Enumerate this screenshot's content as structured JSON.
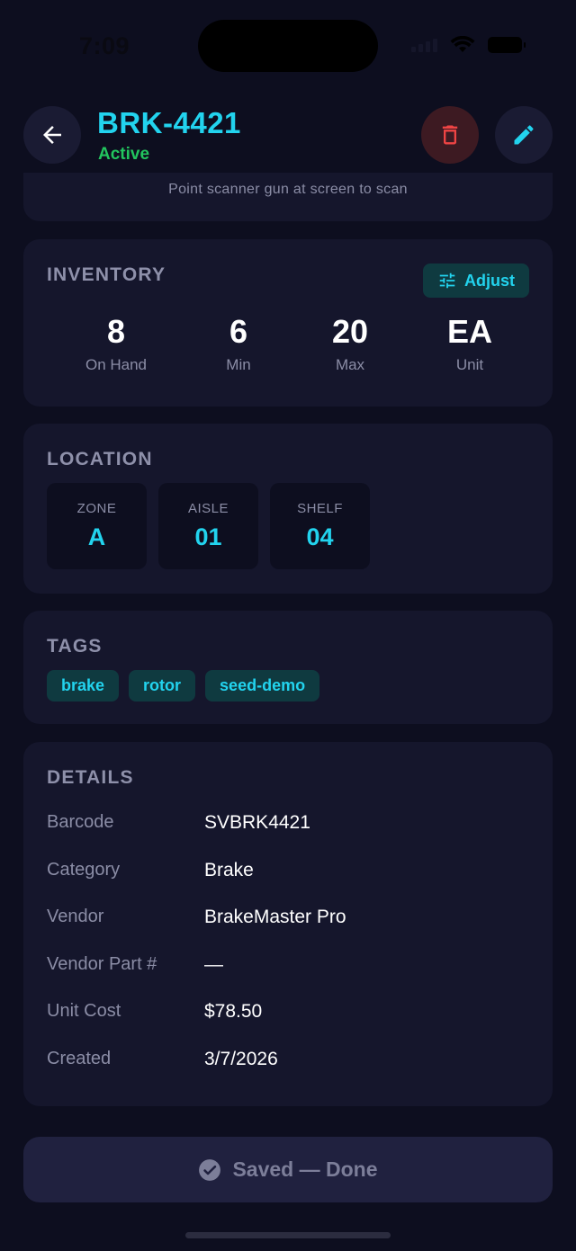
{
  "status_bar": {
    "time": "7:09"
  },
  "header": {
    "title": "BRK-4421",
    "status": "Active",
    "back_icon": "arrow-left-icon",
    "delete_icon": "trash-icon",
    "edit_icon": "pencil-icon"
  },
  "scanner": {
    "hint": "Point scanner gun at screen to scan"
  },
  "inventory": {
    "section_title": "INVENTORY",
    "adjust_label": "Adjust",
    "adjust_icon": "sliders-icon",
    "stats": [
      {
        "value": "8",
        "label": "On Hand"
      },
      {
        "value": "6",
        "label": "Min"
      },
      {
        "value": "20",
        "label": "Max"
      },
      {
        "value": "EA",
        "label": "Unit"
      }
    ]
  },
  "location": {
    "section_title": "LOCATION",
    "zone": {
      "label": "ZONE",
      "value": "A"
    },
    "aisle": {
      "label": "AISLE",
      "value": "01"
    },
    "shelf": {
      "label": "SHELF",
      "value": "04"
    }
  },
  "tags": {
    "section_title": "TAGS",
    "items": [
      "brake",
      "rotor",
      "seed-demo"
    ]
  },
  "details": {
    "section_title": "DETAILS",
    "rows": [
      {
        "label": "Barcode",
        "value": "SVBRK4421"
      },
      {
        "label": "Category",
        "value": "Brake"
      },
      {
        "label": "Vendor",
        "value": "BrakeMaster Pro"
      },
      {
        "label": "Vendor Part #",
        "value": "—"
      },
      {
        "label": "Unit Cost",
        "value": "$78.50"
      },
      {
        "label": "Created",
        "value": "3/7/2026"
      }
    ]
  },
  "footer": {
    "done_label": "Saved — Done",
    "done_icon": "check-circle-icon"
  },
  "colors": {
    "background": "#0d0e1f",
    "card": "#15162c",
    "accent": "#22d3ee",
    "active": "#22c55e",
    "danger": "#ef4444"
  }
}
